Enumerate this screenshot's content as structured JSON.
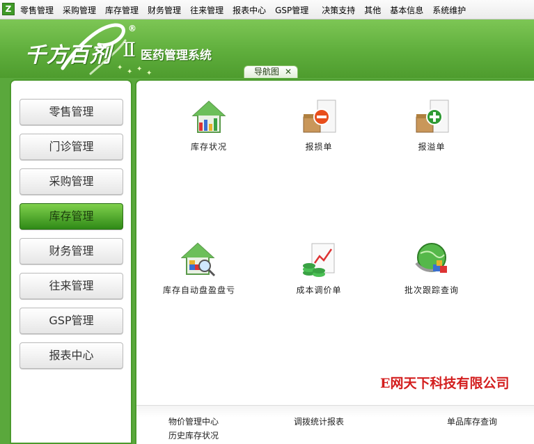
{
  "app_icon": "z-icon",
  "menu": [
    "零售管理",
    "采购管理",
    "库存管理",
    "财务管理",
    "往来管理",
    "报表中心",
    "GSP管理",
    "决策支持",
    "其他",
    "基本信息",
    "系统维护"
  ],
  "brand": {
    "name": "千方百剂",
    "roman": "Ⅱ",
    "reg": "®",
    "subtitle": "医药管理系统"
  },
  "tab": {
    "label": "导航图",
    "close": "✕"
  },
  "sidebar": {
    "items": [
      {
        "label": "零售管理",
        "active": false
      },
      {
        "label": "门诊管理",
        "active": false
      },
      {
        "label": "采购管理",
        "active": false
      },
      {
        "label": "库存管理",
        "active": true
      },
      {
        "label": "财务管理",
        "active": false
      },
      {
        "label": "往来管理",
        "active": false
      },
      {
        "label": "GSP管理",
        "active": false
      },
      {
        "label": "报表中心",
        "active": false
      }
    ]
  },
  "tiles": [
    {
      "label": "库存状况",
      "icon": "house-chart-icon"
    },
    {
      "label": "报损单",
      "icon": "box-minus-icon"
    },
    {
      "label": "报溢单",
      "icon": "box-plus-icon"
    },
    {
      "label": "库存自动盘盈盘亏",
      "icon": "house-magnifier-icon"
    },
    {
      "label": "成本调价单",
      "icon": "coins-chart-icon"
    },
    {
      "label": "批次跟踪查询",
      "icon": "globe-boxes-icon"
    }
  ],
  "company": "E网天下科技有限公司",
  "bottom_links": [
    "物价管理中心",
    "调拨统计报表",
    "单品库存查询",
    "历史库存状况"
  ],
  "colors": {
    "brand_green": "#5aa83c",
    "company_red": "#d31e1e"
  }
}
